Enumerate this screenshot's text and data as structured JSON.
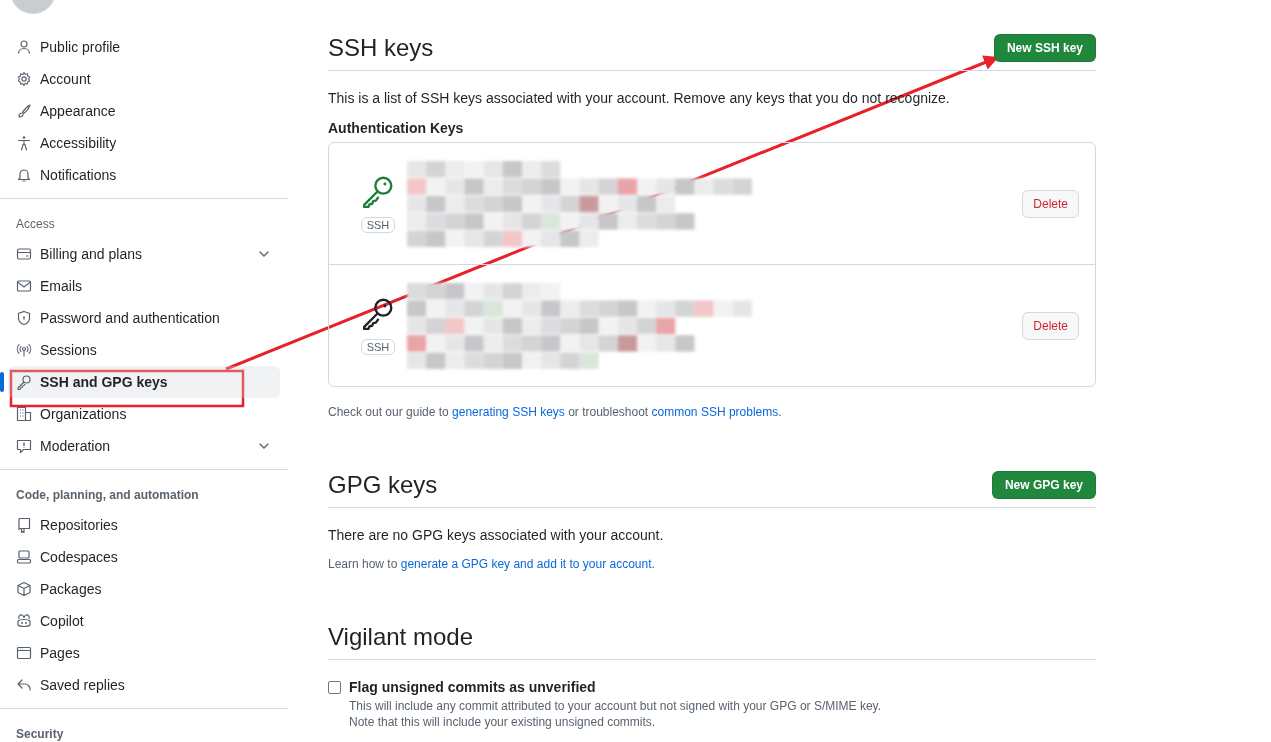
{
  "sidebar": {
    "sections": [
      {
        "items": [
          {
            "label": "Public profile",
            "selected": false
          },
          {
            "label": "Account",
            "selected": false
          },
          {
            "label": "Appearance",
            "selected": false
          },
          {
            "label": "Accessibility",
            "selected": false
          },
          {
            "label": "Notifications",
            "selected": false
          }
        ]
      },
      {
        "heading": "Access",
        "items": [
          {
            "label": "Billing and plans",
            "selected": false,
            "expandable": true
          },
          {
            "label": "Emails",
            "selected": false
          },
          {
            "label": "Password and authentication",
            "selected": false
          },
          {
            "label": "Sessions",
            "selected": false
          },
          {
            "label": "SSH and GPG keys",
            "selected": true
          },
          {
            "label": "Organizations",
            "selected": false
          },
          {
            "label": "Moderation",
            "selected": false,
            "expandable": true
          }
        ]
      },
      {
        "heading": "Code, planning, and automation",
        "items": [
          {
            "label": "Repositories",
            "selected": false
          },
          {
            "label": "Codespaces",
            "selected": false
          },
          {
            "label": "Packages",
            "selected": false
          },
          {
            "label": "Copilot",
            "selected": false
          },
          {
            "label": "Pages",
            "selected": false
          },
          {
            "label": "Saved replies",
            "selected": false
          }
        ]
      },
      {
        "heading": "Security"
      }
    ]
  },
  "ssh": {
    "title": "SSH keys",
    "button": "New SSH key",
    "intro": "This is a list of SSH keys associated with your account. Remove any keys that you do not recognize.",
    "subheading": "Authentication Keys",
    "keys": [
      {
        "badge": "SSH",
        "recently_used": true,
        "action": "Delete"
      },
      {
        "badge": "SSH",
        "recently_used": false,
        "action": "Delete"
      }
    ],
    "help": [
      {
        "kind": "text",
        "text": "Check out our guide to "
      },
      {
        "kind": "link",
        "text": "generating SSH keys"
      },
      {
        "kind": "text",
        "text": " or troubleshoot "
      },
      {
        "kind": "link",
        "text": "common SSH problems"
      },
      {
        "kind": "text",
        "text": "."
      }
    ]
  },
  "gpg": {
    "title": "GPG keys",
    "button": "New GPG key",
    "empty": "There are no GPG keys associated with your account.",
    "help": [
      {
        "kind": "text",
        "text": "Learn how to "
      },
      {
        "kind": "link",
        "text": "generate a GPG key and add it to your account"
      },
      {
        "kind": "text",
        "text": "."
      }
    ]
  },
  "vigilant": {
    "title": "Vigilant mode",
    "option": {
      "label": "Flag unsigned commits as unverified",
      "checked": false,
      "notes": [
        "This will include any commit attributed to your account but not signed with your GPG or S/MIME key.",
        "Note that this will include your existing unsigned commits."
      ]
    }
  },
  "annotations": {
    "arrow": true,
    "highlight_box": true
  }
}
